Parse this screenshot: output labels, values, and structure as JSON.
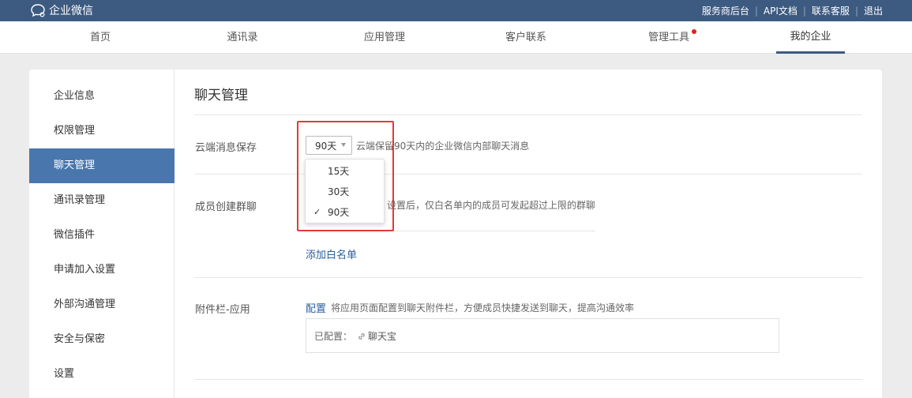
{
  "header": {
    "app_name": "企业微信",
    "links": [
      "服务商后台",
      "API文档",
      "联系客服",
      "退出"
    ],
    "link_separator": "|"
  },
  "nav": {
    "tabs": [
      {
        "label": "首页"
      },
      {
        "label": "通讯录"
      },
      {
        "label": "应用管理"
      },
      {
        "label": "客户联系"
      },
      {
        "label": "管理工具"
      },
      {
        "label": "我的企业"
      }
    ],
    "active_tab": "我的企业"
  },
  "sidebar": {
    "items": [
      {
        "label": "企业信息"
      },
      {
        "label": "权限管理"
      },
      {
        "label": "聊天管理"
      },
      {
        "label": "通讯录管理"
      },
      {
        "label": "微信插件"
      },
      {
        "label": "申请加入设置"
      },
      {
        "label": "外部沟通管理"
      },
      {
        "label": "安全与保密"
      },
      {
        "label": "设置"
      }
    ],
    "active_item": "聊天管理"
  },
  "main": {
    "title": "聊天管理",
    "cloud_storage": {
      "label": "云端消息保存",
      "selected": "90天",
      "hint": "云端保留90天内的企业微信内部聊天消息",
      "options": [
        "15天",
        "30天",
        "90天"
      ]
    },
    "group_chat": {
      "label": "成员创建群聊",
      "hint": "设置后，仅白名单内的成员可发起超过上限的群聊",
      "add_whitelist_link": "添加白名单"
    },
    "attachment": {
      "label": "附件栏-应用",
      "config_link": "配置",
      "hint": "将应用页面配置到聊天附件栏，方便成员快捷发送到聊天，提高沟通效率",
      "configured_label": "已配置：",
      "configured_app": "聊天宝"
    }
  },
  "colors": {
    "topbar": "#3d5a80",
    "sidebar_active": "#4a76ae",
    "link": "#2b5f9e",
    "highlight_box": "#e53935",
    "badge_dot": "#e02020"
  }
}
